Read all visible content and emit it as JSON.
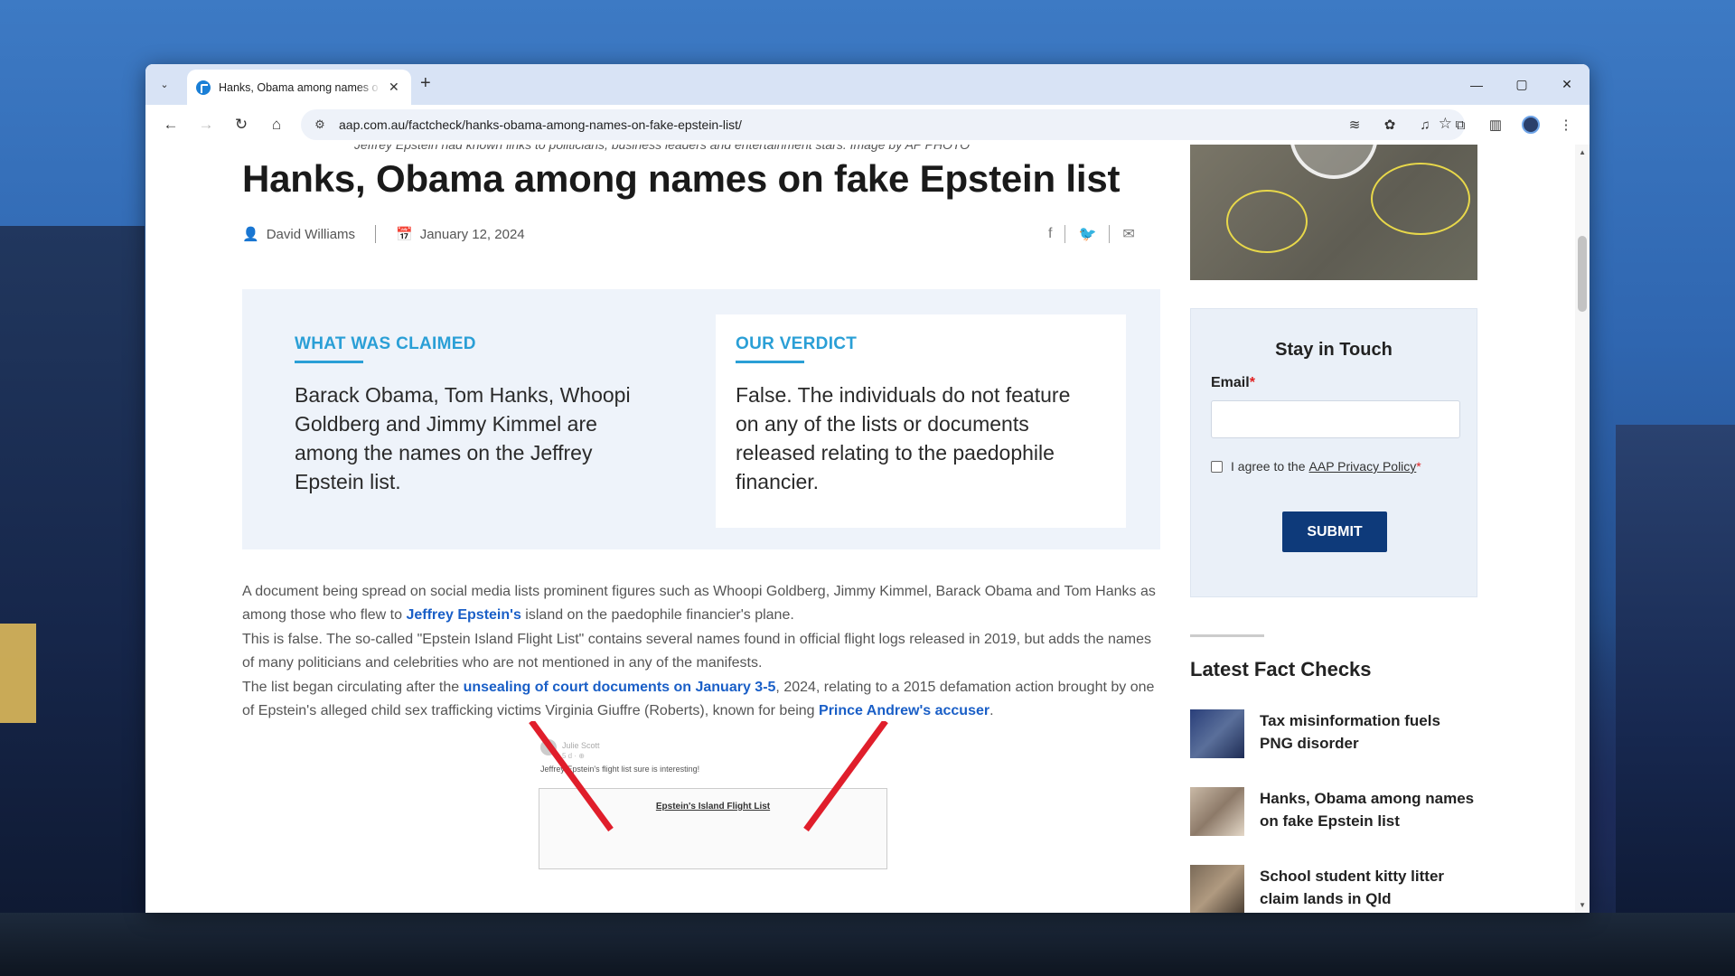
{
  "browser": {
    "tab_title": "Hanks, Obama among names o",
    "tab_close": "✕",
    "new_tab": "+",
    "url": "aap.com.au/factcheck/hanks-obama-among-names-on-fake-epstein-list/",
    "window_controls": {
      "minimize": "—",
      "maximize": "▢",
      "close": "✕"
    }
  },
  "article": {
    "caption_above": "Jeffrey Epstein had known links to politicians, business leaders and entertainment stars. Image by AP PHOTO",
    "title": "Hanks, Obama among names on fake Epstein list",
    "author": "David Williams",
    "date": "January 12, 2024",
    "share": {
      "facebook": "f",
      "twitter": "🐦",
      "email": "✉"
    },
    "claim": {
      "heading": "WHAT WAS CLAIMED",
      "text": "Barack Obama, Tom Hanks, Whoopi Goldberg and Jimmy Kimmel are among the names on the Jeffrey Epstein list."
    },
    "verdict": {
      "heading": "OUR VERDICT",
      "text": "False. The individuals do not feature on any of the lists or documents released relating to the paedophile financier."
    },
    "paragraphs": {
      "p1_a": "A document being spread on social media lists prominent figures such as Whoopi Goldberg, Jimmy Kimmel, Barack Obama and Tom Hanks as among those who flew to ",
      "p1_link": "Jeffrey Epstein's",
      "p1_b": " island on the paedophile financier's plane.",
      "p2": "This is false. The so-called \"Epstein Island Flight List\" contains several names found in official flight logs released in 2019, but adds the names of many politicians and celebrities who are not mentioned in any of the manifests.",
      "p3_a": "The list began circulating after the ",
      "p3_link1": "unsealing of court documents on January 3-5",
      "p3_b": ", 2024, relating to a 2015 defamation action brought by one of Epstein's alleged child sex trafficking victims Virginia Giuffre (Roberts), known for being ",
      "p3_link2": "Prince Andrew's accuser",
      "p3_c": "."
    },
    "embedded_image": {
      "post_name": "Julie Scott",
      "post_meta": "5 d · ⊕",
      "post_text": "Jeffrey Epstein's flight list sure is interesting!",
      "doc_title": "Epstein's Island Flight List"
    }
  },
  "sidebar": {
    "newsletter": {
      "title": "Stay in Touch",
      "email_label": "Email",
      "required_mark": "*",
      "agree_text": "I agree to the",
      "privacy_link": "AAP Privacy Policy",
      "submit": "SUBMIT"
    },
    "latest": {
      "title": "Latest Fact Checks",
      "items": [
        {
          "title": "Tax misinformation fuels PNG disorder"
        },
        {
          "title": "Hanks, Obama among names on fake Epstein list"
        },
        {
          "title": "School student kitty litter claim lands in Qld"
        }
      ]
    }
  },
  "colors": {
    "accent": "#2a9fd6",
    "link": "#1a5fc7",
    "submit_bg": "#0e3a7a",
    "verdict_bg": "#eef3fa"
  }
}
